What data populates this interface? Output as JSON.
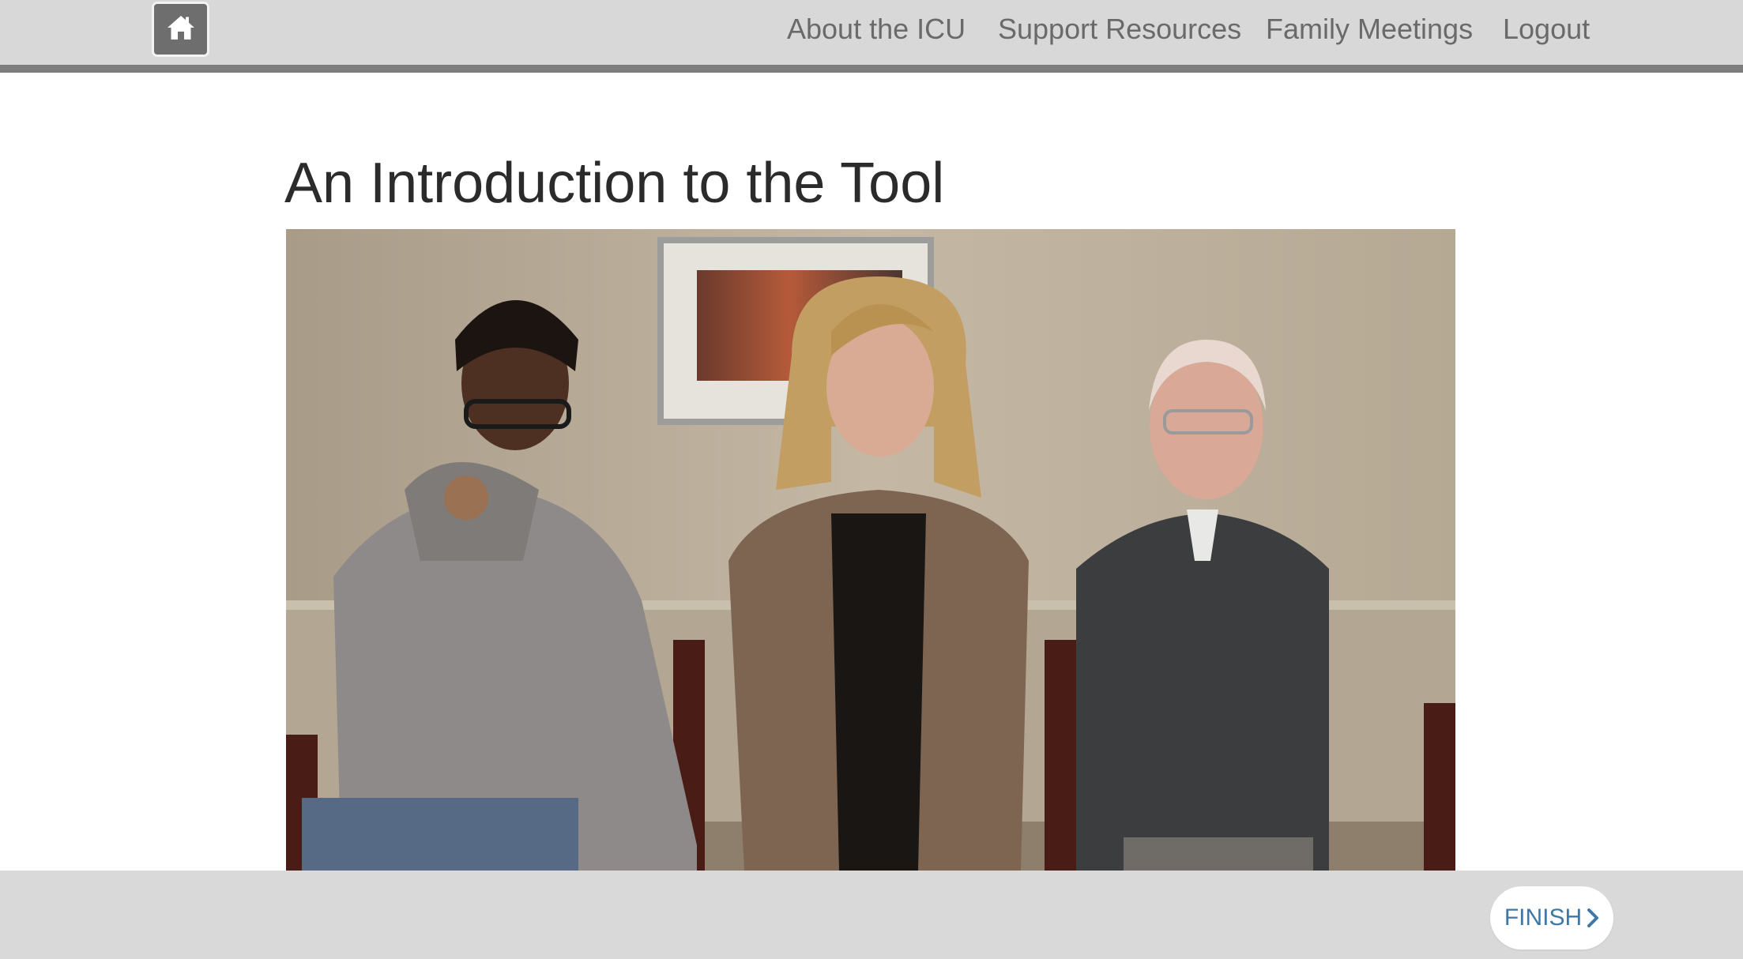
{
  "nav": {
    "home_icon": "home-icon",
    "links": [
      "About the ICU",
      "Support Resources",
      "Family Meetings",
      "Logout"
    ]
  },
  "page": {
    "title": "An Introduction to the Tool"
  },
  "footer": {
    "finish_label": "FINISH",
    "finish_icon": "chevron-right-icon"
  },
  "colors": {
    "nav_bar": "#d8d8d8",
    "nav_rule": "#7d7d7d",
    "home_button": "#6e6e6e",
    "nav_text": "#6a6a6a",
    "finish_text": "#3e78a8"
  }
}
